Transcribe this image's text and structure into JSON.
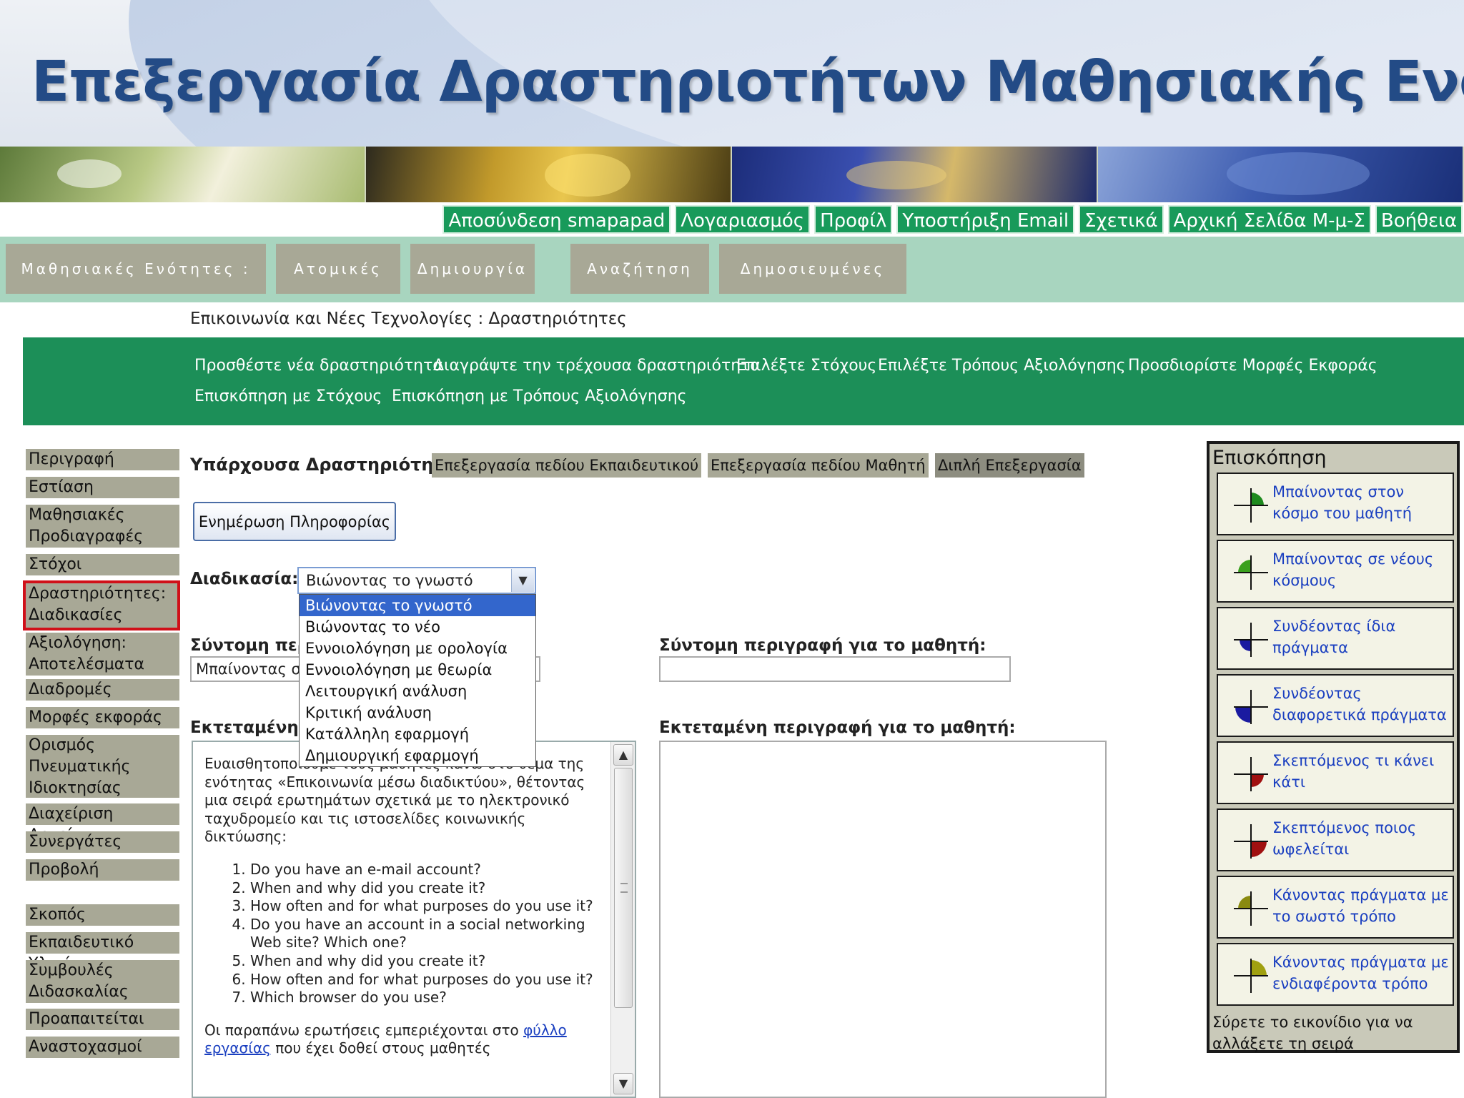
{
  "slide": {
    "title": "Επεξεργασία Δραστηριοτήτων Μαθησιακής Ενότητας"
  },
  "top_links": [
    "Αποσύνδεση smapapad",
    "Λογαριασμός",
    "Προφίλ",
    "Υποστήριξη Email",
    "Σχετικά",
    "Αρχική Σελίδα Μ-μ-Σ",
    "Βοήθεια"
  ],
  "tabs": [
    "Μαθησιακές Ενότητες :",
    "Ατομικές",
    "Δημιουργία",
    "Αναζήτηση",
    "Δημοσιευμένες"
  ],
  "breadcrumb": "Επικοινωνία και Νέες Τεχνολογίες : Δραστηριότητες",
  "actions": {
    "add": "Προσθέστε νέα δραστηριότητα",
    "delete": "Διαγράψτε την τρέχουσα δραστηριότητα",
    "select_goals": "Επιλέξτε Στόχους",
    "select_assessment": "Επιλέξτε Τρόπους Αξιολόγησης",
    "define_forms": "Προσδιορίστε Μορφές Εκφοράς",
    "overview_goals": "Επισκόπηση με Στόχους",
    "overview_assessment": "Επισκόπηση με Τρόπους Αξιολόγησης"
  },
  "sidebar": {
    "items": [
      "Περιγραφή",
      "Εστίαση",
      "Μαθησιακές Προδιαγραφές",
      "Στόχοι",
      "Δραστηριότητες: Διαδικασίες",
      "Αξιολόγηση: Αποτελέσματα",
      "Διαδρομές",
      "Μορφές εκφοράς",
      "Ορισμός Πνευματικής Ιδιοκτησίας",
      "Διαχείριση Αρχείων",
      "Συνεργάτες",
      "Προβολή"
    ],
    "items2": [
      "Σκοπός",
      "Εκπαιδευτικό Υλικό",
      "Συμβουλές Διδασκαλίας",
      "Προαπαιτείται",
      "Αναστοχασμοί"
    ],
    "active_index": 4
  },
  "main": {
    "existing_label": "Υπάρχουσα Δραστηριότητα",
    "edit_teacher": "Επεξεργασία πεδίου Εκπαιδευτικού",
    "edit_student": "Επεξεργασία πεδίου Μαθητή",
    "double_edit": "Διπλή Επεξεργασία",
    "update_button": "Ενημέρωση Πληροφορίας",
    "process_label": "Διαδικασία:",
    "process_value": "Βιώνοντας το γνωστό",
    "process_options": [
      "Βιώνοντας το γνωστό",
      "Βιώνοντας το νέο",
      "Εννοιολόγηση με ορολογία",
      "Εννοιολόγηση με θεωρία",
      "Λειτουργική ανάλυση",
      "Κριτική ανάλυση",
      "Κατάλληλη εφαρμογή",
      "Δημιουργική εφαρμογή"
    ],
    "short_teacher_label": "Σύντομη περι",
    "short_teacher_value": "Μπαίνοντας σ",
    "short_student_label": "Σύντομη περιγραφή για το μαθητή:",
    "short_student_value": "",
    "long_teacher_label": "Εκτεταμένη π",
    "long_student_label": "Εκτεταμένη περιγραφή για το μαθητή:",
    "long_text_intro": "Ευαισθητοποιούμε τους μαθητές πάνω στο θέμα της ενότητας «Επικοινωνία μέσω διαδικτύου», θέτοντας μια σειρά ερωτημάτων σχετικά με το ηλεκτρονικό ταχυδρομείο και τις ιστοσελίδες κοινωνικής δικτύωσης:",
    "long_text_list": [
      "Do you have an e-mail account?",
      "When and why did you create it?",
      "How often and for what purposes do you use it?",
      "Do you have an account in a social networking Web site? Which one?",
      "When and why did you create it?",
      "How often and for what purposes do you use it?",
      "Which browser do you use?"
    ],
    "long_text_outro_pre": "Οι παραπάνω ερωτήσεις εμπεριέχονται στο",
    "long_text_link": "φύλλο εργασίας",
    "long_text_outro_post": "που έχει δοθεί στους μαθητές"
  },
  "overview": {
    "title": "Επισκόπηση",
    "cards": [
      {
        "label": "Μπαίνοντας στον κόσμο του μαθητή",
        "color": "#1e8a1e",
        "quadrant": "tr",
        "icon": "quadrant-icon"
      },
      {
        "label": "Μπαίνοντας σε νέους κόσμους",
        "color": "#3aa01e",
        "quadrant": "tl",
        "icon": "quadrant-icon"
      },
      {
        "label": "Συνδέοντας ίδια πράγματα",
        "color": "#1a1aa0",
        "quadrant": "bl",
        "icon": "quadrant-icon"
      },
      {
        "label": "Συνδέοντας διαφορετικά πράγματα",
        "color": "#1a1aa0",
        "quadrant": "bl2",
        "icon": "quadrant-icon"
      },
      {
        "label": "Σκεπτόμενος τι κάνει κάτι",
        "color": "#a01010",
        "quadrant": "br",
        "icon": "quadrant-icon"
      },
      {
        "label": "Σκεπτόμενος ποιος ωφελείται",
        "color": "#a01010",
        "quadrant": "br2",
        "icon": "quadrant-icon"
      },
      {
        "label": "Κάνοντας πράγματα με το σωστό τρόπο",
        "color": "#8a8a10",
        "quadrant": "tl",
        "icon": "quadrant-icon"
      },
      {
        "label": "Κάνοντας πράγματα με ενδιαφέροντα τρόπο",
        "color": "#a0a010",
        "quadrant": "tr2",
        "icon": "quadrant-icon"
      }
    ],
    "note": "Σύρετε το εικονίδιο για να αλλάξετε τη σειρά"
  }
}
